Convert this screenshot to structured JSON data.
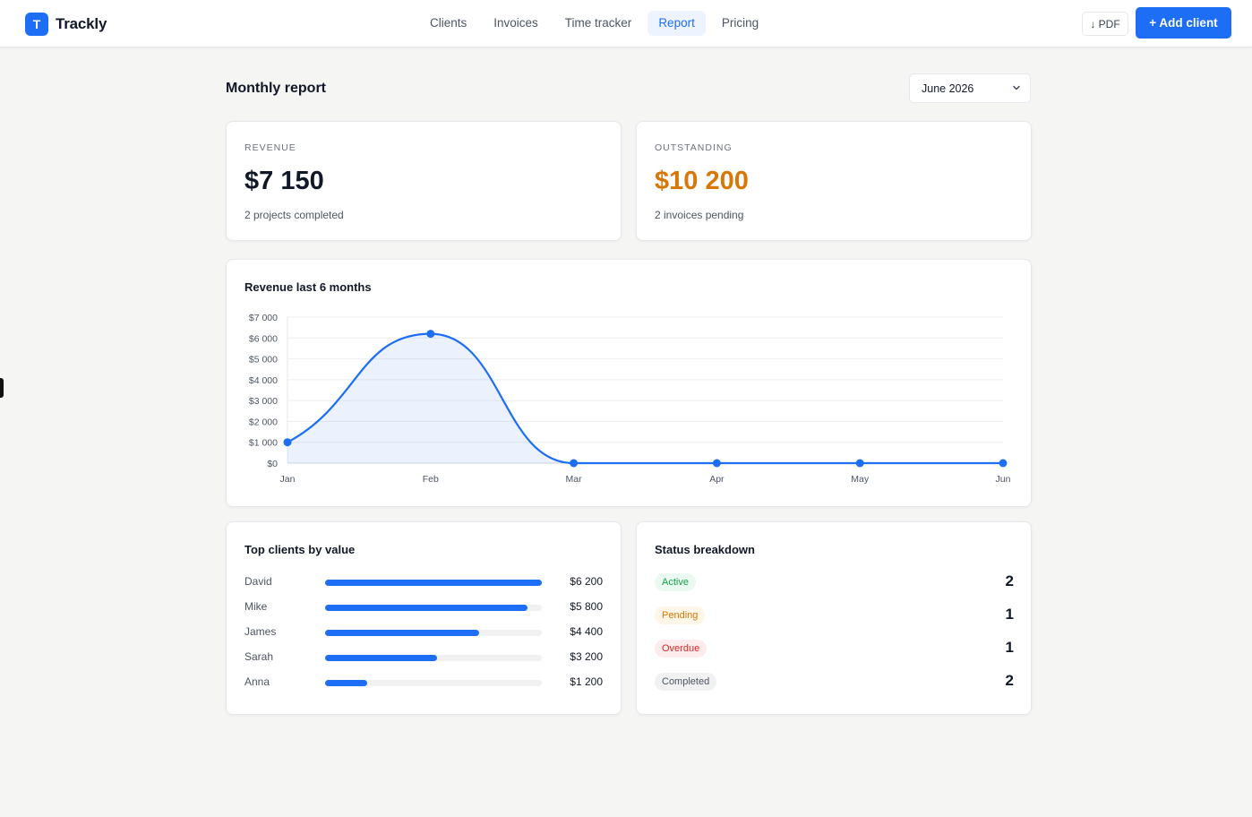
{
  "brand": {
    "logo_letter": "T",
    "name": "Trackly",
    "accent": "#1d6ef5"
  },
  "nav": {
    "items": [
      {
        "label": "Clients",
        "active": false
      },
      {
        "label": "Invoices",
        "active": false
      },
      {
        "label": "Time tracker",
        "active": false
      },
      {
        "label": "Report",
        "active": true
      },
      {
        "label": "Pricing",
        "active": false
      }
    ]
  },
  "actions": {
    "pdf_label": "↓ PDF",
    "add_client_label": "+ Add client"
  },
  "report": {
    "title": "Monthly report",
    "month_selected": "June 2026"
  },
  "kpis": {
    "revenue": {
      "label": "REVENUE",
      "value": "$7 150",
      "sub": "2 projects completed"
    },
    "outstanding": {
      "label": "OUTSTANDING",
      "value": "$10 200",
      "sub": "2 invoices pending",
      "color": "#d97706"
    }
  },
  "chart_data": {
    "type": "area",
    "title": "Revenue last 6 months",
    "categories": [
      "Jan",
      "Feb",
      "Mar",
      "Apr",
      "May",
      "Jun"
    ],
    "values": [
      1000,
      6200,
      0,
      0,
      0,
      0
    ],
    "y_ticks": [
      "$0",
      "$1 000",
      "$2 000",
      "$3 000",
      "$4 000",
      "$5 000",
      "$6 000",
      "$7 000"
    ],
    "ylim": [
      0,
      7000
    ],
    "grid": true,
    "color": "#1d6ef5"
  },
  "top_clients": {
    "title": "Top clients by value",
    "max_value": 6200,
    "rows": [
      {
        "name": "David",
        "value": 6200,
        "value_label": "$6 200"
      },
      {
        "name": "Mike",
        "value": 5800,
        "value_label": "$5 800"
      },
      {
        "name": "James",
        "value": 4400,
        "value_label": "$4 400"
      },
      {
        "name": "Sarah",
        "value": 3200,
        "value_label": "$3 200"
      },
      {
        "name": "Anna",
        "value": 1200,
        "value_label": "$1 200"
      }
    ]
  },
  "status_breakdown": {
    "title": "Status breakdown",
    "rows": [
      {
        "label": "Active",
        "count": "2",
        "kind": "active"
      },
      {
        "label": "Pending",
        "count": "1",
        "kind": "pending"
      },
      {
        "label": "Overdue",
        "count": "1",
        "kind": "overdue"
      },
      {
        "label": "Completed",
        "count": "2",
        "kind": "completed"
      }
    ]
  }
}
